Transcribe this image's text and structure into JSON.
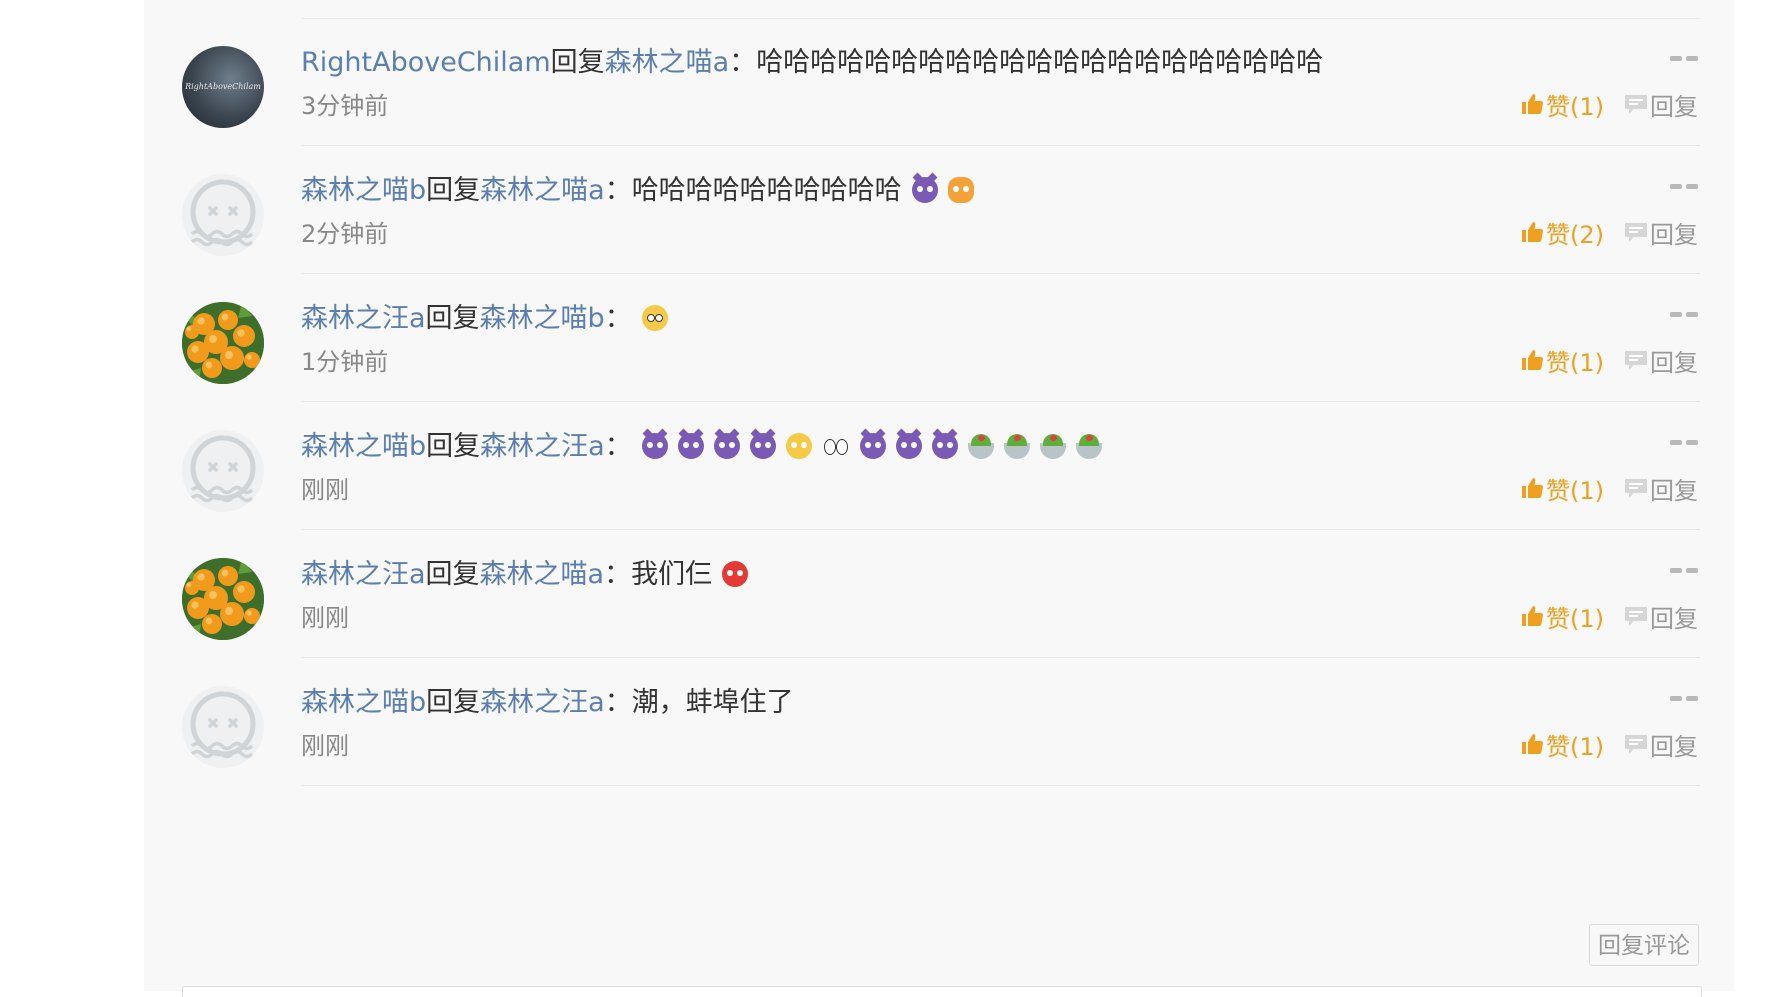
{
  "comments": [
    {
      "author": "RightAboveChilam",
      "reply_word": "回复",
      "target": "森林之喵a",
      "colon": "：",
      "content": "哈哈哈哈哈哈哈哈哈哈哈哈哈哈哈哈哈哈哈哈哈",
      "emojis": [],
      "time": "3分钟前",
      "like_label": "赞(1)",
      "reply_label": "回复",
      "avatar": "photo",
      "avatar_text": "RightAboveChilam"
    },
    {
      "author": "森林之喵b",
      "reply_word": "回复",
      "target": "森林之喵a",
      "colon": "：",
      "content": "哈哈哈哈哈哈哈哈哈哈",
      "emojis": [
        "devil",
        "cat"
      ],
      "time": "2分钟前",
      "like_label": "赞(2)",
      "reply_label": "回复",
      "avatar": "default"
    },
    {
      "author": "森林之汪a",
      "reply_word": "回复",
      "target": "森林之喵b",
      "colon": "：",
      "content": "",
      "emojis": [
        "scream"
      ],
      "time": "1分钟前",
      "like_label": "赞(1)",
      "reply_label": "回复",
      "avatar": "oranges"
    },
    {
      "author": "森林之喵b",
      "reply_word": "回复",
      "target": "森林之汪a",
      "colon": "：",
      "content": "",
      "emojis": [
        "devil",
        "devil",
        "devil",
        "devil",
        "yum",
        "peek",
        "devil",
        "devil",
        "devil",
        "salad",
        "salad",
        "salad",
        "salad"
      ],
      "time": "刚刚",
      "like_label": "赞(1)",
      "reply_label": "回复",
      "avatar": "default"
    },
    {
      "author": "森林之汪a",
      "reply_word": "回复",
      "target": "森林之喵a",
      "colon": "：",
      "content": "我们仨",
      "emojis": [
        "angry"
      ],
      "time": "刚刚",
      "like_label": "赞(1)",
      "reply_label": "回复",
      "avatar": "oranges"
    },
    {
      "author": "森林之喵b",
      "reply_word": "回复",
      "target": "森林之汪a",
      "colon": "：",
      "content": "潮，蚌埠住了",
      "emojis": [],
      "time": "刚刚",
      "like_label": "赞(1)",
      "reply_label": "回复",
      "avatar": "default"
    }
  ],
  "reply_comment_button": "回复评论",
  "colors": {
    "name": "#5b7fb0",
    "like": "#f0a020",
    "muted": "#999999",
    "panel": "#f8f8f8"
  }
}
